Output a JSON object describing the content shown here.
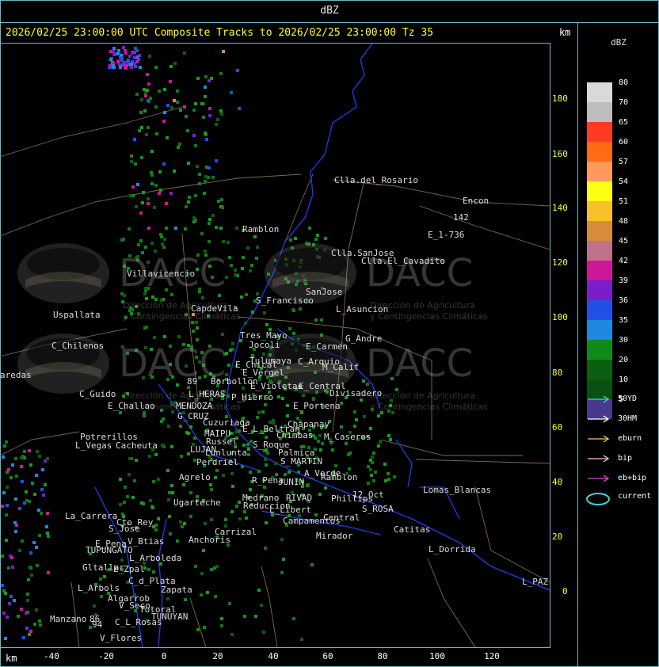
{
  "window": {
    "title": "dBZ"
  },
  "headline": "2026/02/25 23:00:00 UTC Composite Tracks to 2026/02/25 23:00:00 Tz 35",
  "axis_unit_top": "km",
  "axis_unit_bottom": "km",
  "x_ticks": [
    "-40",
    "-20",
    "0",
    "20",
    "40",
    "60",
    "80",
    "100",
    "120"
  ],
  "y_ticks": [
    "180",
    "160",
    "140",
    "120",
    "100",
    "80",
    "60",
    "40",
    "20",
    "0"
  ],
  "legend": {
    "title": "dBZ",
    "scale": [
      {
        "label": "80",
        "color": "#d9d9d9"
      },
      {
        "label": "70",
        "color": "#bdbdbd"
      },
      {
        "label": "65",
        "color": "#ff3b24"
      },
      {
        "label": "60",
        "color": "#ff6a14"
      },
      {
        "label": "57",
        "color": "#ff9a5c"
      },
      {
        "label": "54",
        "color": "#ffff12"
      },
      {
        "label": "51",
        "color": "#f6c22a"
      },
      {
        "label": "48",
        "color": "#d88b38"
      },
      {
        "label": "45",
        "color": "#c0708a"
      },
      {
        "label": "42",
        "color": "#cc1898"
      },
      {
        "label": "39",
        "color": "#7a1ec8"
      },
      {
        "label": "36",
        "color": "#2050e6"
      },
      {
        "label": "35",
        "color": "#1d8ae0"
      },
      {
        "label": "30",
        "color": "#118a18"
      },
      {
        "label": "20",
        "color": "#0a6010"
      },
      {
        "label": "10",
        "color": "#0a5010"
      },
      {
        "label": "5",
        "color": "#453a8c"
      }
    ],
    "tracks": [
      {
        "label": "50YD",
        "color": "#3fd4d8",
        "kind": "arrow"
      },
      {
        "label": "30HM",
        "color": "#ffffff",
        "kind": "arrow"
      },
      {
        "label": "eburn",
        "color": "#f2c27a",
        "kind": "arrow"
      },
      {
        "label": "bip",
        "color": "#ffc8c8",
        "kind": "arrow"
      },
      {
        "label": "eb+bip",
        "color": "#d84cd8",
        "kind": "arrow"
      },
      {
        "label": "current",
        "color": "#3fd4d8",
        "kind": "ellipse"
      }
    ]
  },
  "watermark": {
    "text": "DACC",
    "subtitle_1": "Dirección de Agricultura",
    "subtitle_2": "y Contingencias Climáticas"
  },
  "places": [
    {
      "name": "Clla.del_Rosario"
    },
    {
      "name": "Encon"
    },
    {
      "name": "142"
    },
    {
      "name": "E_1-736"
    },
    {
      "name": "Ramblon"
    },
    {
      "name": "Clla.SanJose"
    },
    {
      "name": "Clla.El_Cavadito"
    },
    {
      "name": "Villavicencio"
    },
    {
      "name": "CapdeVila"
    },
    {
      "name": "S_Francisco"
    },
    {
      "name": "SanJose"
    },
    {
      "name": "L_Asuncion"
    },
    {
      "name": "Uspallata"
    },
    {
      "name": "Tres_Mayo"
    },
    {
      "name": "Jocoli"
    },
    {
      "name": "Tulumaya"
    },
    {
      "name": "G_Andre"
    },
    {
      "name": "E_Carmen"
    },
    {
      "name": "C_Chilenos"
    },
    {
      "name": "E_Chical"
    },
    {
      "name": "E_Vergel"
    },
    {
      "name": "C_Arquio"
    },
    {
      "name": "M_Calif"
    },
    {
      "name": "aredas"
    },
    {
      "name": "Borbollon"
    },
    {
      "name": "E_Violetas"
    },
    {
      "name": "E_Central"
    },
    {
      "name": "C_Guido"
    },
    {
      "name": "L_HERAS"
    },
    {
      "name": "P_Hierro"
    },
    {
      "name": "Divisadero"
    },
    {
      "name": "E_Challao"
    },
    {
      "name": "MENDOZA"
    },
    {
      "name": "E_Portena"
    },
    {
      "name": "G_CRUZ"
    },
    {
      "name": "Cuzuriaga"
    },
    {
      "name": "Chapanay"
    },
    {
      "name": "E_L_Beltran"
    },
    {
      "name": "Potrerillos"
    },
    {
      "name": "MAIPU"
    },
    {
      "name": "Chimbas"
    },
    {
      "name": "M_Caseros"
    },
    {
      "name": "L_Vegas"
    },
    {
      "name": "Cacheuta"
    },
    {
      "name": "Russel"
    },
    {
      "name": "S_Roque"
    },
    {
      "name": "LUJAN"
    },
    {
      "name": "Lunlunta"
    },
    {
      "name": "Palmica"
    },
    {
      "name": "Perdriel"
    },
    {
      "name": "S_MARTIN"
    },
    {
      "name": "A_Verde"
    },
    {
      "name": "Agrelo"
    },
    {
      "name": "Ramblon"
    },
    {
      "name": "R_Pena"
    },
    {
      "name": "JUNIN"
    },
    {
      "name": "12_Oct"
    },
    {
      "name": "Lomas_Blancas"
    },
    {
      "name": "Ugarteche"
    },
    {
      "name": "Medrano"
    },
    {
      "name": "RIVAD"
    },
    {
      "name": "Phillips"
    },
    {
      "name": "Reduccion"
    },
    {
      "name": "La_Carrera"
    },
    {
      "name": "L_Libert"
    },
    {
      "name": "S_ROSA"
    },
    {
      "name": "Cto_Rey"
    },
    {
      "name": "S_Jose"
    },
    {
      "name": "Campamentos"
    },
    {
      "name": "Central"
    },
    {
      "name": "Catitas"
    },
    {
      "name": "Carrizal"
    },
    {
      "name": "V_Btias"
    },
    {
      "name": "Anchoris"
    },
    {
      "name": "Mirador"
    },
    {
      "name": "E_Pena"
    },
    {
      "name": "TUPUNGATO"
    },
    {
      "name": "L_Dorrida"
    },
    {
      "name": "L_Arboleda"
    },
    {
      "name": "Gltallar"
    },
    {
      "name": "E_Zpal"
    },
    {
      "name": "C_d_Plata"
    },
    {
      "name": "L_PAZ"
    },
    {
      "name": "L_Arbols"
    },
    {
      "name": "Zapata"
    },
    {
      "name": "Algarrob"
    },
    {
      "name": "V_Seco"
    },
    {
      "name": "Totoral"
    },
    {
      "name": "TUNUYAN"
    },
    {
      "name": "Manzano"
    },
    {
      "name": "C_L_Rosas"
    },
    {
      "name": "V_Flores"
    },
    {
      "name": "94"
    },
    {
      "name": "86"
    },
    {
      "name": "89"
    }
  ]
}
